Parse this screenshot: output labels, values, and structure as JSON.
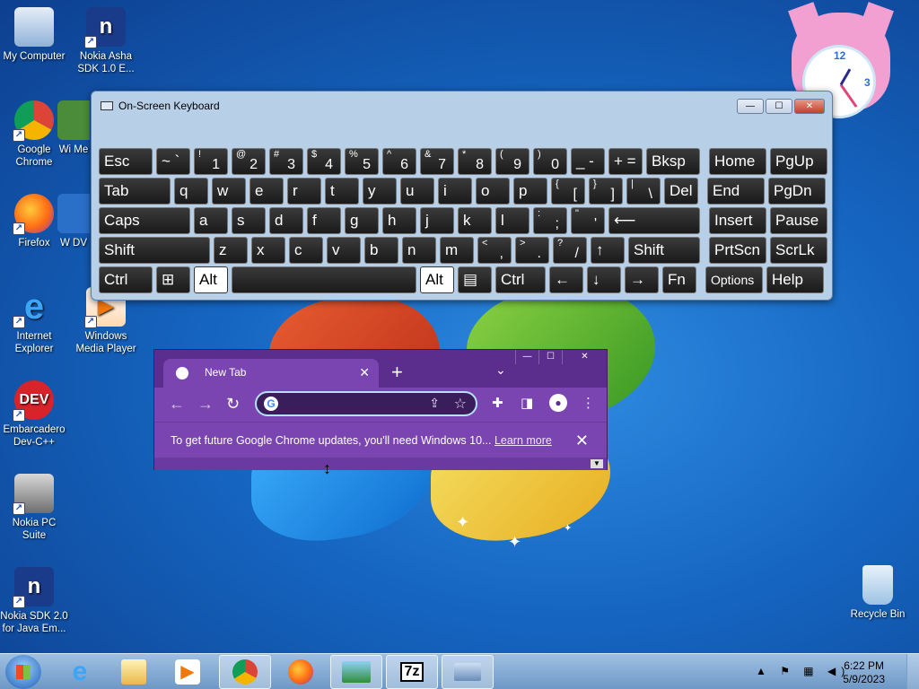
{
  "desktop": {
    "icons": [
      {
        "label": "My Computer"
      },
      {
        "label": "Nokia Asha SDK 1.0 E..."
      },
      {
        "label": "Google Chrome"
      },
      {
        "label": "Wi Me"
      },
      {
        "label": "Firefox"
      },
      {
        "label": "W DV"
      },
      {
        "label": "Internet Explorer"
      },
      {
        "label": "Windows Media Player"
      },
      {
        "label": "Embarcadero Dev-C++"
      },
      {
        "label": "Nokia PC Suite"
      },
      {
        "label": "Nokia SDK 2.0 for Java Em..."
      },
      {
        "label": "Recycle Bin"
      }
    ],
    "icon_glyphs": {
      "nokia": "n",
      "dev": "DEV"
    }
  },
  "osk": {
    "title": "On-Screen Keyboard",
    "rows": [
      [
        {
          "t": "Esc"
        },
        {
          "t": "~ `"
        },
        {
          "a": "!",
          "b": "1"
        },
        {
          "a": "@",
          "b": "2"
        },
        {
          "a": "#",
          "b": "3"
        },
        {
          "a": "$",
          "b": "4"
        },
        {
          "a": "%",
          "b": "5"
        },
        {
          "a": "^",
          "b": "6"
        },
        {
          "a": "&",
          "b": "7"
        },
        {
          "a": "*",
          "b": "8"
        },
        {
          "a": "(",
          "b": "9"
        },
        {
          "a": ")",
          "b": "0"
        },
        {
          "t": "_ -"
        },
        {
          "t": "+ ="
        },
        {
          "t": "Bksp"
        },
        {
          "t": "Home"
        },
        {
          "t": "PgUp"
        }
      ],
      [
        {
          "t": "Tab"
        },
        {
          "t": "q"
        },
        {
          "t": "w"
        },
        {
          "t": "e"
        },
        {
          "t": "r"
        },
        {
          "t": "t"
        },
        {
          "t": "y"
        },
        {
          "t": "u"
        },
        {
          "t": "i"
        },
        {
          "t": "o"
        },
        {
          "t": "p"
        },
        {
          "a": "{",
          "b": "["
        },
        {
          "a": "}",
          "b": "]"
        },
        {
          "a": "|",
          "b": "\\"
        },
        {
          "t": "Del"
        },
        {
          "t": "End"
        },
        {
          "t": "PgDn"
        }
      ],
      [
        {
          "t": "Caps"
        },
        {
          "t": "a"
        },
        {
          "t": "s"
        },
        {
          "t": "d"
        },
        {
          "t": "f"
        },
        {
          "t": "g"
        },
        {
          "t": "h"
        },
        {
          "t": "j"
        },
        {
          "t": "k"
        },
        {
          "t": "l"
        },
        {
          "a": ":",
          "b": ";"
        },
        {
          "a": "\"",
          "b": "'"
        },
        {
          "t": "⟵"
        },
        {
          "t": "Insert"
        },
        {
          "t": "Pause"
        }
      ],
      [
        {
          "t": "Shift"
        },
        {
          "t": "z"
        },
        {
          "t": "x"
        },
        {
          "t": "c"
        },
        {
          "t": "v"
        },
        {
          "t": "b"
        },
        {
          "t": "n"
        },
        {
          "t": "m"
        },
        {
          "a": "<",
          "b": ","
        },
        {
          "a": ">",
          "b": "."
        },
        {
          "a": "?",
          "b": "/"
        },
        {
          "t": "↑"
        },
        {
          "t": "Shift"
        },
        {
          "t": "PrtScn"
        },
        {
          "t": "ScrLk"
        }
      ],
      [
        {
          "t": "Ctrl"
        },
        {
          "t": "⊞"
        },
        {
          "t": "Alt"
        },
        {
          "t": ""
        },
        {
          "t": "Alt"
        },
        {
          "t": "▤"
        },
        {
          "t": "Ctrl"
        },
        {
          "t": "←"
        },
        {
          "t": "↓"
        },
        {
          "t": "→"
        },
        {
          "t": "Fn"
        },
        {
          "t": "Options"
        },
        {
          "t": "Help"
        }
      ]
    ]
  },
  "chrome": {
    "tab_title": "New Tab",
    "infobar_text": "To get future Google Chrome updates, you'll need Windows 10...",
    "infobar_link": "Learn more",
    "controls": {
      "minimize": "—",
      "maximize": "☐",
      "close": "✕",
      "newtab": "+",
      "tab_close": "✕",
      "chevron": "⌄"
    },
    "nav": {
      "back": "←",
      "forward": "→",
      "reload": "↻"
    },
    "omnibox_glyph": "G"
  },
  "clock": {
    "numbers": {
      "n12": "12",
      "n3": "3"
    }
  },
  "taskbar": {
    "buttons": [
      {
        "name": "Internet Explorer"
      },
      {
        "name": "Windows Explorer"
      },
      {
        "name": "Windows Media Player"
      },
      {
        "name": "Google Chrome"
      },
      {
        "name": "Firefox"
      },
      {
        "name": "Picture viewer"
      },
      {
        "name": "7-Zip",
        "glyph": "7z"
      },
      {
        "name": "On-Screen Keyboard"
      }
    ],
    "tray": {
      "time": "6:22 PM",
      "date": "5/9/2023",
      "icons": "▲ ⚑ ▦ ◀)"
    }
  },
  "colors": {
    "chrome_frame": "#5b2d8c",
    "chrome_tab": "#7a45b0",
    "osk_bg": "#b8cfe8"
  }
}
